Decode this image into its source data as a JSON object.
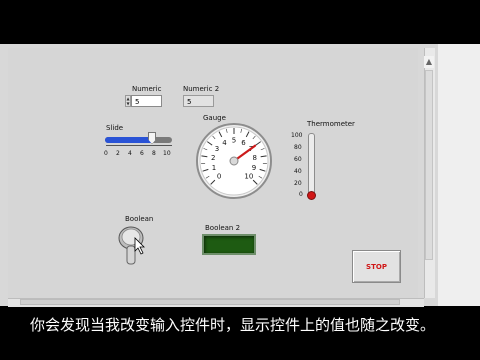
{
  "controls": {
    "numeric": {
      "label": "Numeric",
      "value": "5"
    },
    "numeric2": {
      "label": "Numeric 2",
      "value": "5"
    },
    "slide": {
      "label": "Slide",
      "value": 8,
      "ticks": [
        "0",
        "2",
        "4",
        "6",
        "8",
        "10"
      ]
    },
    "gauge": {
      "label": "Gauge",
      "value": 7,
      "ticks": [
        "0",
        "1",
        "2",
        "3",
        "4",
        "5",
        "6",
        "7",
        "8",
        "9",
        "10"
      ]
    },
    "thermometer": {
      "label": "Thermometer",
      "value": 0,
      "ticks": [
        "100",
        "80",
        "60",
        "40",
        "20",
        "0"
      ]
    },
    "boolean": {
      "label": "Boolean"
    },
    "boolean2": {
      "label": "Boolean 2"
    },
    "stop": {
      "label": "STOP"
    }
  },
  "colors": {
    "slide_fill": "#2a53d6",
    "needle": "#cc1b1b",
    "led_off": "#1e5b12",
    "stop_text": "#d01616"
  },
  "subtitle": "你会发现当我改变输入控件时，显示控件上的值也随之改变。"
}
